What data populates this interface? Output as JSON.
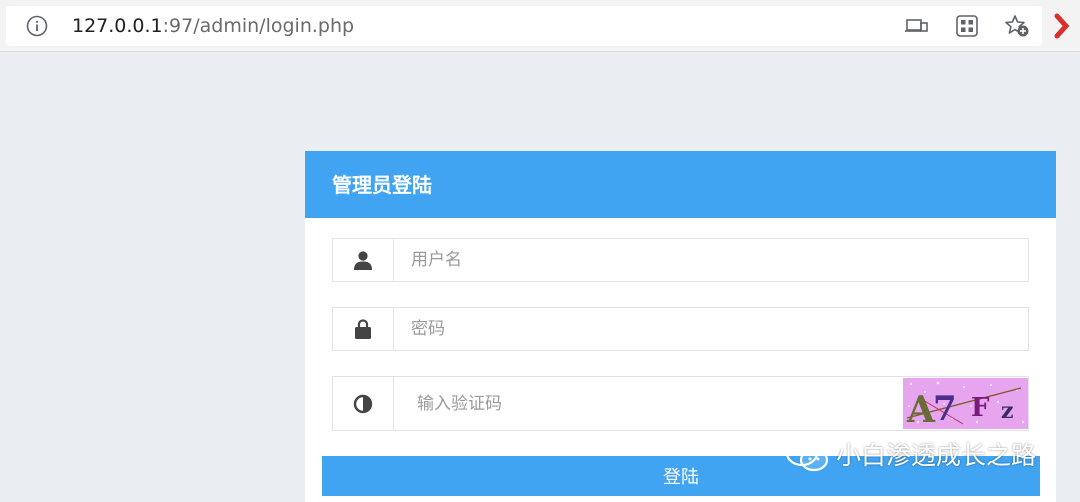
{
  "browser": {
    "url_host": "127.0.0.1",
    "url_rest": ":97/admin/login.php",
    "icons": [
      "info-icon",
      "cast-icon",
      "apps-icon",
      "star-add-icon"
    ]
  },
  "login": {
    "title": "管理员登陆",
    "username_placeholder": "用户名",
    "password_placeholder": "密码",
    "captcha_placeholder": "输入验证码",
    "captcha_text": "A7Fz",
    "submit_label": "登陆",
    "accent_color": "#40a4f2"
  },
  "watermark": {
    "text": "小白渗透成长之路"
  }
}
